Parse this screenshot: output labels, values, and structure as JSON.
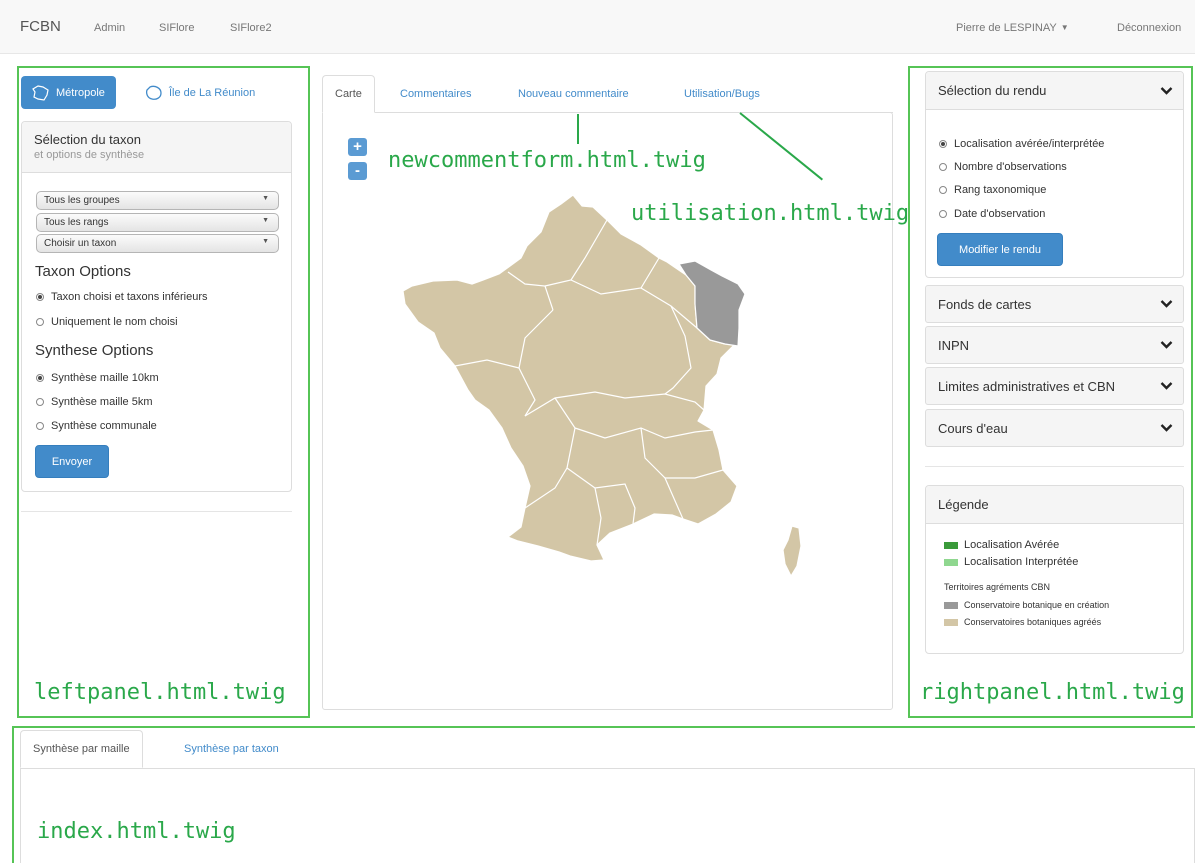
{
  "navbar": {
    "brand": "FCBN",
    "links": [
      "Admin",
      "SIFlore",
      "SIFlore2"
    ],
    "user": "Pierre de LESPINAY",
    "logout": "Déconnexion"
  },
  "left_panel": {
    "region_tabs": {
      "active": "Métropole",
      "other": "Île de La Réunion"
    },
    "taxon_panel": {
      "title": "Sélection du taxon",
      "subtitle": "et options de synthèse"
    },
    "selects": [
      "Tous les groupes",
      "Tous les rangs",
      "Choisir un taxon"
    ],
    "taxon_options": {
      "title": "Taxon Options",
      "options": [
        "Taxon choisi et taxons inférieurs",
        "Uniquement le nom choisi"
      ],
      "selected": 0
    },
    "synthese_options": {
      "title": "Synthese Options",
      "options": [
        "Synthèse maille 10km",
        "Synthèse maille 5km",
        "Synthèse communale"
      ],
      "selected": 0
    },
    "submit_label": "Envoyer"
  },
  "center": {
    "tabs": [
      "Carte",
      "Commentaires",
      "Nouveau commentaire",
      "Utilisation/Bugs"
    ],
    "active_tab": "Carte",
    "zoom_in": "+",
    "zoom_out": "-"
  },
  "right_panel": {
    "rendu": {
      "title": "Sélection du rendu",
      "options": [
        "Localisation avérée/interprétée",
        "Nombre d'observations",
        "Rang taxonomique",
        "Date d'observation"
      ],
      "selected": 0,
      "button": "Modifier le rendu"
    },
    "accordion": [
      "Fonds de cartes",
      "INPN",
      "Limites administratives et CBN",
      "Cours d'eau"
    ],
    "legend": {
      "title": "Légende",
      "items": [
        {
          "label": "Localisation Avérée",
          "color": "#3a9a3a"
        },
        {
          "label": "Localisation Interprétée",
          "color": "#8fd78f"
        }
      ],
      "subtitle": "Territoires agréments CBN",
      "territories": [
        {
          "label": "Conservatoire botanique en création",
          "color": "#999999"
        },
        {
          "label": "Conservatoires botaniques agréés",
          "color": "#d3c6a6"
        }
      ]
    }
  },
  "bottom": {
    "tabs": [
      "Synthèse par maille",
      "Synthèse par taxon"
    ],
    "active_tab": "Synthèse par maille"
  },
  "annotations": {
    "left": "leftpanel.html.twig",
    "right": "rightpanel.html.twig",
    "index": "index.html.twig",
    "newcomment": "newcommentform.html.twig",
    "utilisation": "utilisation.html.twig"
  },
  "colors": {
    "accent": "#428bca",
    "annotation": "#2aa84a",
    "map_land": "#d3c6a6",
    "map_highlight": "#999999",
    "map_border": "#ffffff"
  }
}
